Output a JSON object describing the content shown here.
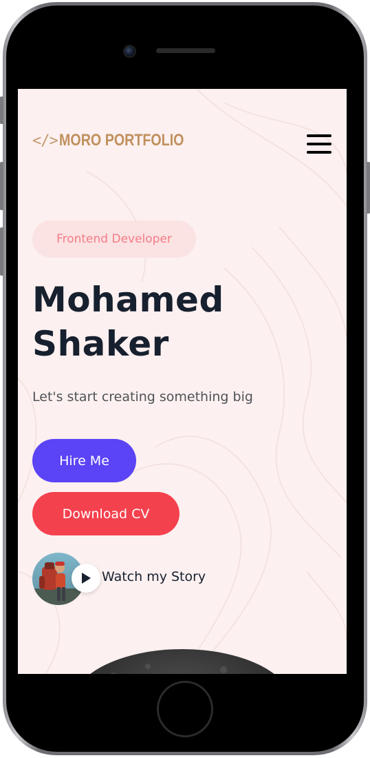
{
  "header": {
    "logo_code": "</>",
    "logo_text": "MORO PORTFOLIO"
  },
  "hero": {
    "role_badge": "Frontend Developer",
    "name_line_1": "Mohamed",
    "name_line_2": "Shaker",
    "tagline": "Let's start creating something big"
  },
  "actions": {
    "hire_label": "Hire Me",
    "cv_label": "Download CV"
  },
  "story": {
    "label": "Watch my Story"
  },
  "icons": {
    "menu": "hamburger-menu-icon",
    "play": "play-icon"
  },
  "colors": {
    "background": "#fcf0f0",
    "logo": "#c0905e",
    "badge_bg": "#fbe2e3",
    "badge_text": "#f47c84",
    "heading": "#17202e",
    "hire_button": "#5b44f5",
    "cv_button": "#f4414e"
  }
}
